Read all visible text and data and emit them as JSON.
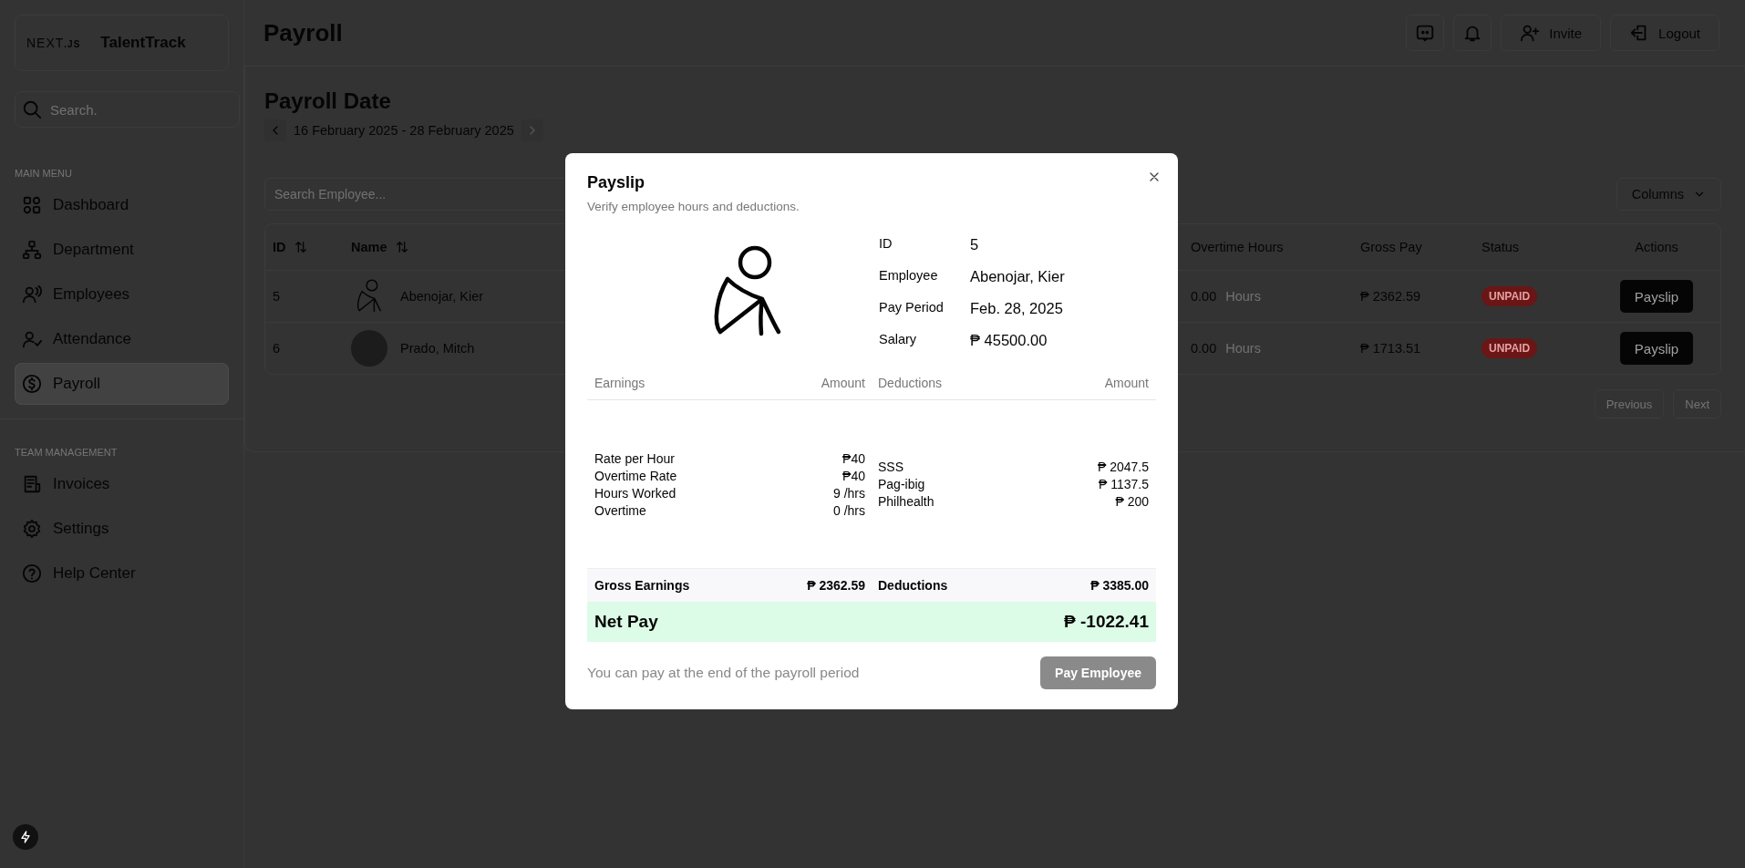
{
  "sidebar": {
    "logo": {
      "wordmark": "NEXT",
      "suffix": ".JS"
    },
    "app_name": "TalentTrack",
    "search": {
      "placeholder": "Search."
    },
    "sections": [
      {
        "title": "MAIN MENU",
        "items": [
          {
            "label": "Dashboard",
            "selected": false
          },
          {
            "label": "Department",
            "selected": false
          },
          {
            "label": "Employees",
            "selected": false
          },
          {
            "label": "Attendance",
            "selected": false
          },
          {
            "label": "Payroll",
            "selected": true
          }
        ]
      },
      {
        "title": "TEAM MANAGEMENT",
        "items": [
          {
            "label": "Invoices",
            "selected": false
          },
          {
            "label": "Settings",
            "selected": false
          },
          {
            "label": "Help Center",
            "selected": false
          }
        ]
      }
    ]
  },
  "header": {
    "title": "Payroll",
    "actions": [
      {
        "kind": "chat"
      },
      {
        "kind": "bell"
      },
      {
        "kind": "invite",
        "label": "Invite"
      },
      {
        "kind": "logout",
        "label": "Logout"
      }
    ]
  },
  "payroll": {
    "heading": "Payroll Date",
    "date_range": "16 February 2025 - 28 February 2025",
    "search": {
      "placeholder": "Search Employee..."
    },
    "columns_button": "Columns",
    "table": {
      "columns": [
        {
          "label": "ID",
          "sortable": true
        },
        {
          "label": "Name",
          "sortable": true
        },
        {
          "label": "Overtime Hours",
          "sortable": false
        },
        {
          "label": "Gross Pay",
          "sortable": false
        },
        {
          "label": "Status",
          "sortable": false
        },
        {
          "label": "Actions",
          "sortable": false
        }
      ],
      "rows": [
        {
          "id": "5",
          "kind": "drawing",
          "name": "Abenojar, Kier",
          "overtime": "0.00",
          "unit": "Hours",
          "gross_pay": "₱ 2362.59",
          "status": "UNPAID",
          "paid": false,
          "action": "Payslip"
        },
        {
          "id": "6",
          "kind": "photo",
          "name": "Prado, Mitch",
          "overtime": "0.00",
          "unit": "Hours",
          "gross_pay": "₱ 1713.51",
          "status": "UNPAID",
          "paid": false,
          "action": "Payslip"
        }
      ]
    },
    "pagination": {
      "previous": "Previous",
      "next": "Next"
    }
  },
  "modal": {
    "title": "Payslip",
    "subtitle": "Verify employee hours and deductions.",
    "info": [
      {
        "label": "ID",
        "value": "5"
      },
      {
        "label": "Employee",
        "value": "Abenojar, Kier"
      },
      {
        "label": "Pay Period",
        "value": "Feb. 28, 2025"
      },
      {
        "label": "Salary",
        "value": "₱ 45500.00"
      }
    ],
    "earnings": {
      "heading": "Earnings",
      "amount_heading": "Amount",
      "rows": [
        {
          "label": "Rate per Hour",
          "amount": "₱40"
        },
        {
          "label": "Overtime Rate",
          "amount": "₱40"
        },
        {
          "label": "Hours Worked",
          "amount": "9 /hrs"
        },
        {
          "label": "Overtime",
          "amount": "0 /hrs"
        }
      ]
    },
    "deductions": {
      "heading": "Deductions",
      "amount_heading": "Amount",
      "rows": [
        {
          "label": "SSS",
          "amount": "₱ 2047.5"
        },
        {
          "label": "Pag-ibig",
          "amount": "₱ 1137.5"
        },
        {
          "label": "Philhealth",
          "amount": "₱ 200"
        }
      ]
    },
    "totals": {
      "gross_label": "Gross Earnings",
      "gross_value": "₱ 2362.59",
      "deductions_label": "Deductions",
      "deductions_value": "₱ 3385.00"
    },
    "net_pay": {
      "label": "Net Pay",
      "value": "₱ -1022.41"
    },
    "note": "You can pay at the end of the payroll period",
    "pay_button": {
      "label": "Pay Employee",
      "disabled": true
    }
  }
}
